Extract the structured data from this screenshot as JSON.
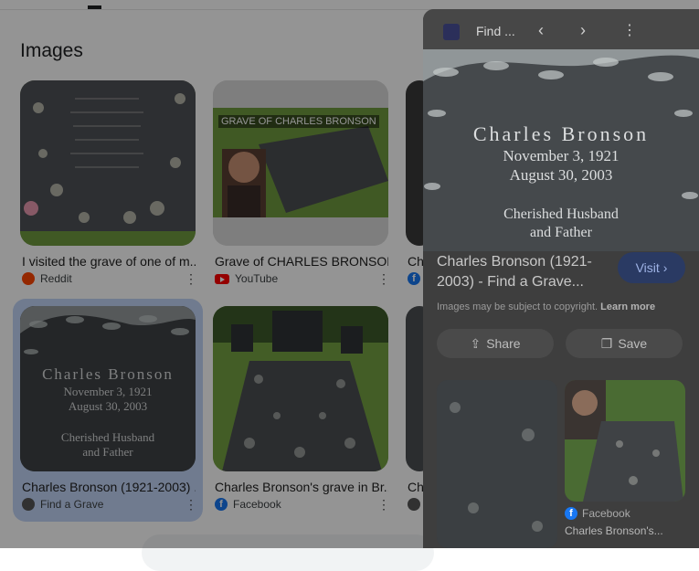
{
  "section_heading": "Images",
  "results": [
    {
      "title": "I visited the grave of one of m...",
      "source": "Reddit",
      "source_icon": "reddit-icon"
    },
    {
      "title": "Grave of CHARLES BRONSON...",
      "source": "YouTube",
      "source_icon": "youtube-icon",
      "overlay_text": "GRAVE OF CHARLES BRONSON"
    },
    {
      "title": "Ch",
      "source": "",
      "source_icon": "facebook-icon"
    },
    {
      "title": "Charles Bronson (1921-2003) ...",
      "source": "Find a Grave",
      "source_icon": "findagrave-icon",
      "selected": true
    },
    {
      "title": "Charles Bronson's grave in Br...",
      "source": "Facebook",
      "source_icon": "facebook-icon"
    },
    {
      "title": "Ch",
      "source": "",
      "source_icon": "findagrave-icon"
    }
  ],
  "headstone_text": {
    "name": "Charles Bronson",
    "birth": "November 3, 1921",
    "death": "August 30, 2003",
    "epitaph_line1": "Cherished Husband",
    "epitaph_line2": "and Father"
  },
  "panel": {
    "site_title": "Find ...",
    "image_title": "Charles Bronson (1921-2003) - Find a Grave...",
    "visit_label": "Visit",
    "copyright_text": "Images may be subject to copyright.",
    "learn_more": "Learn more",
    "share_label": "Share",
    "save_label": "Save",
    "related_source": "Facebook",
    "related_caption": "Charles Bronson's..."
  },
  "colors": {
    "selected_bg": "#c2d5f7",
    "grass": "#6f9a3f",
    "stone": "#4b4e51"
  }
}
